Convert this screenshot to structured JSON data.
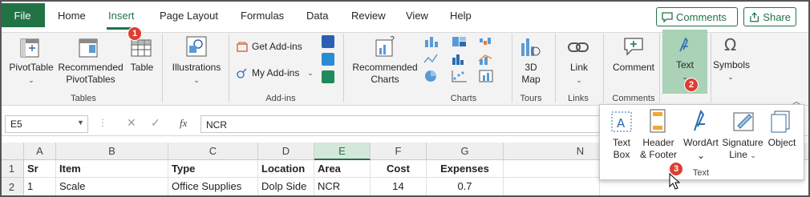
{
  "tabs": {
    "file": "File",
    "home": "Home",
    "insert": "Insert",
    "page_layout": "Page Layout",
    "formulas": "Formulas",
    "data": "Data",
    "review": "Review",
    "view": "View",
    "help": "Help"
  },
  "top_buttons": {
    "comments": "Comments",
    "share": "Share"
  },
  "ribbon": {
    "pivottable": "PivotTable",
    "recommended_pivot_1": "Recommended",
    "recommended_pivot_2": "PivotTables",
    "table": "Table",
    "illustrations": "Illustrations",
    "get_addins": "Get Add-ins",
    "my_addins": "My Add-ins",
    "recommended_charts_1": "Recommended",
    "recommended_charts_2": "Charts",
    "map_1": "3D",
    "map_2": "Map",
    "link": "Link",
    "comment": "Comment",
    "text": "Text",
    "symbols": "Symbols",
    "groups": {
      "tables": "Tables",
      "addins": "Add-ins",
      "charts": "Charts",
      "tours": "Tours",
      "links": "Links",
      "comments": "Comments",
      "text": "Text"
    }
  },
  "badges": {
    "one": "1",
    "two": "2",
    "three": "3"
  },
  "formula_bar": {
    "name_box": "E5",
    "fx": "fx",
    "value": "NCR"
  },
  "columns": [
    "A",
    "B",
    "C",
    "D",
    "E",
    "F",
    "G",
    "N"
  ],
  "rows": [
    "1",
    "2"
  ],
  "header_row": [
    "Sr",
    "Item",
    "Type",
    "Location",
    "Area",
    "Cost",
    "Expenses"
  ],
  "data_row": [
    "1",
    "Scale",
    "Office Supplies",
    "Dolp Side",
    "NCR",
    "14",
    "0.7"
  ],
  "text_menu": {
    "textbox_1": "Text",
    "textbox_2": "Box",
    "header_1": "Header",
    "header_2": "& Footer",
    "wordart": "WordArt",
    "signature_1": "Signature",
    "signature_2": "Line",
    "object": "Object",
    "group": "Text"
  },
  "colors": {
    "accent": "#217346",
    "badge": "#e03c2f",
    "highlight": "#a9d2b6"
  }
}
